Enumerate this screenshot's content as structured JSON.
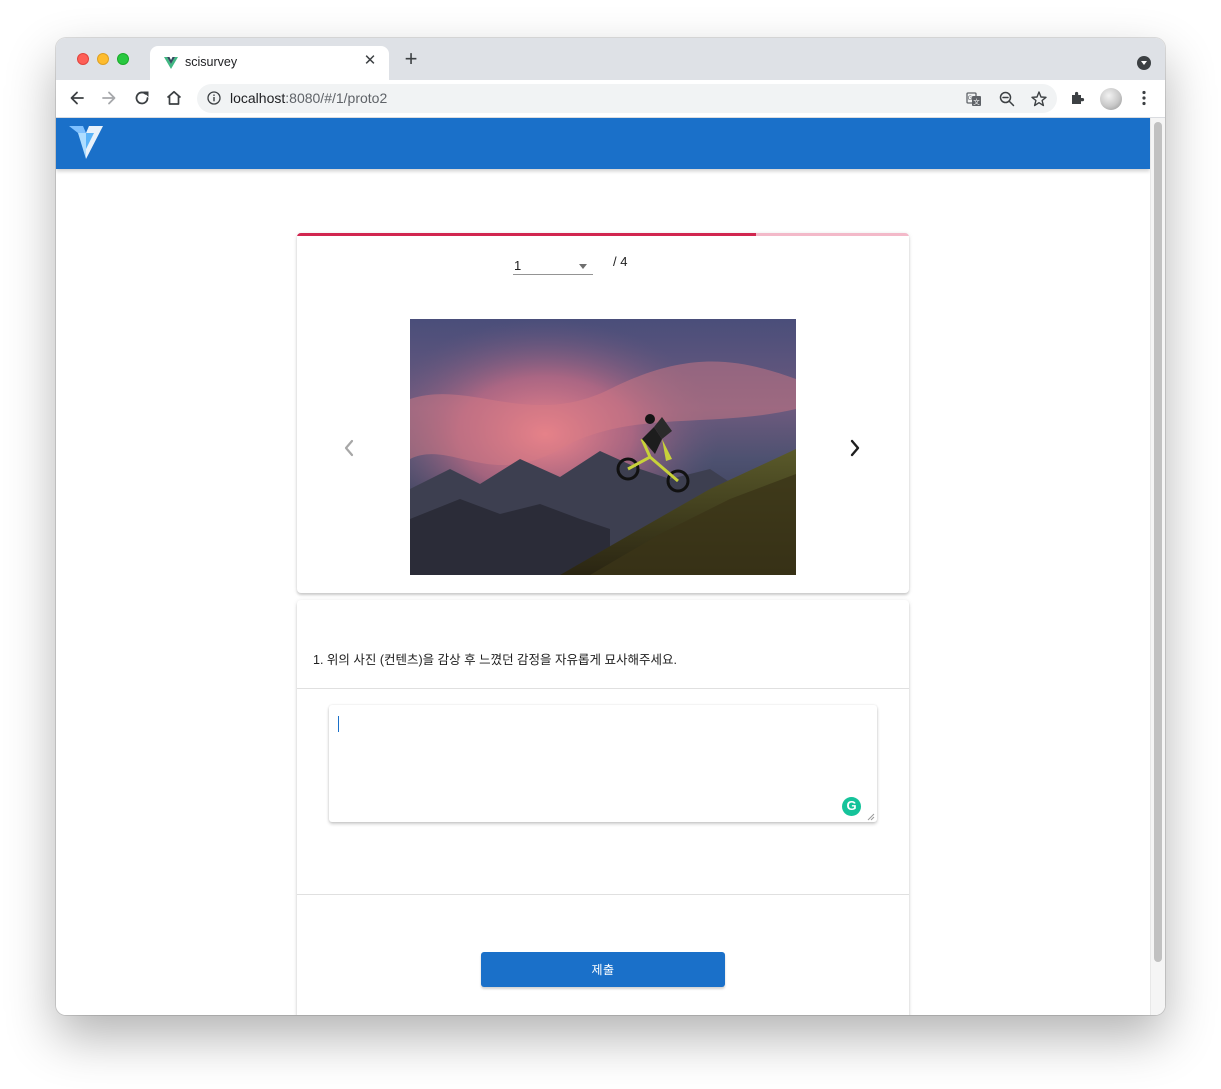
{
  "browser": {
    "tab_title": "scisurvey",
    "close_glyph": "✕",
    "new_tab_glyph": "+",
    "url_host": "localhost",
    "url_rest": ":8080/#/1/proto2"
  },
  "app": {
    "brand_color": "#1a70c9",
    "logo_icon": "vuetify-logo-icon"
  },
  "survey": {
    "current_page": "1",
    "total_pages": "/ 4",
    "progress_fraction": 0.75,
    "progress_color": "#d1264f",
    "progress_track_color": "#f3b9c9",
    "image": {
      "subject": "mountain-biker-at-sunset-photo"
    },
    "question": "1. 위의 사진 (컨텐츠)을 감상 후 느꼈던 감정을 자유롭게 묘사해주세요.",
    "answer_value": "",
    "submit_label": "제출"
  }
}
